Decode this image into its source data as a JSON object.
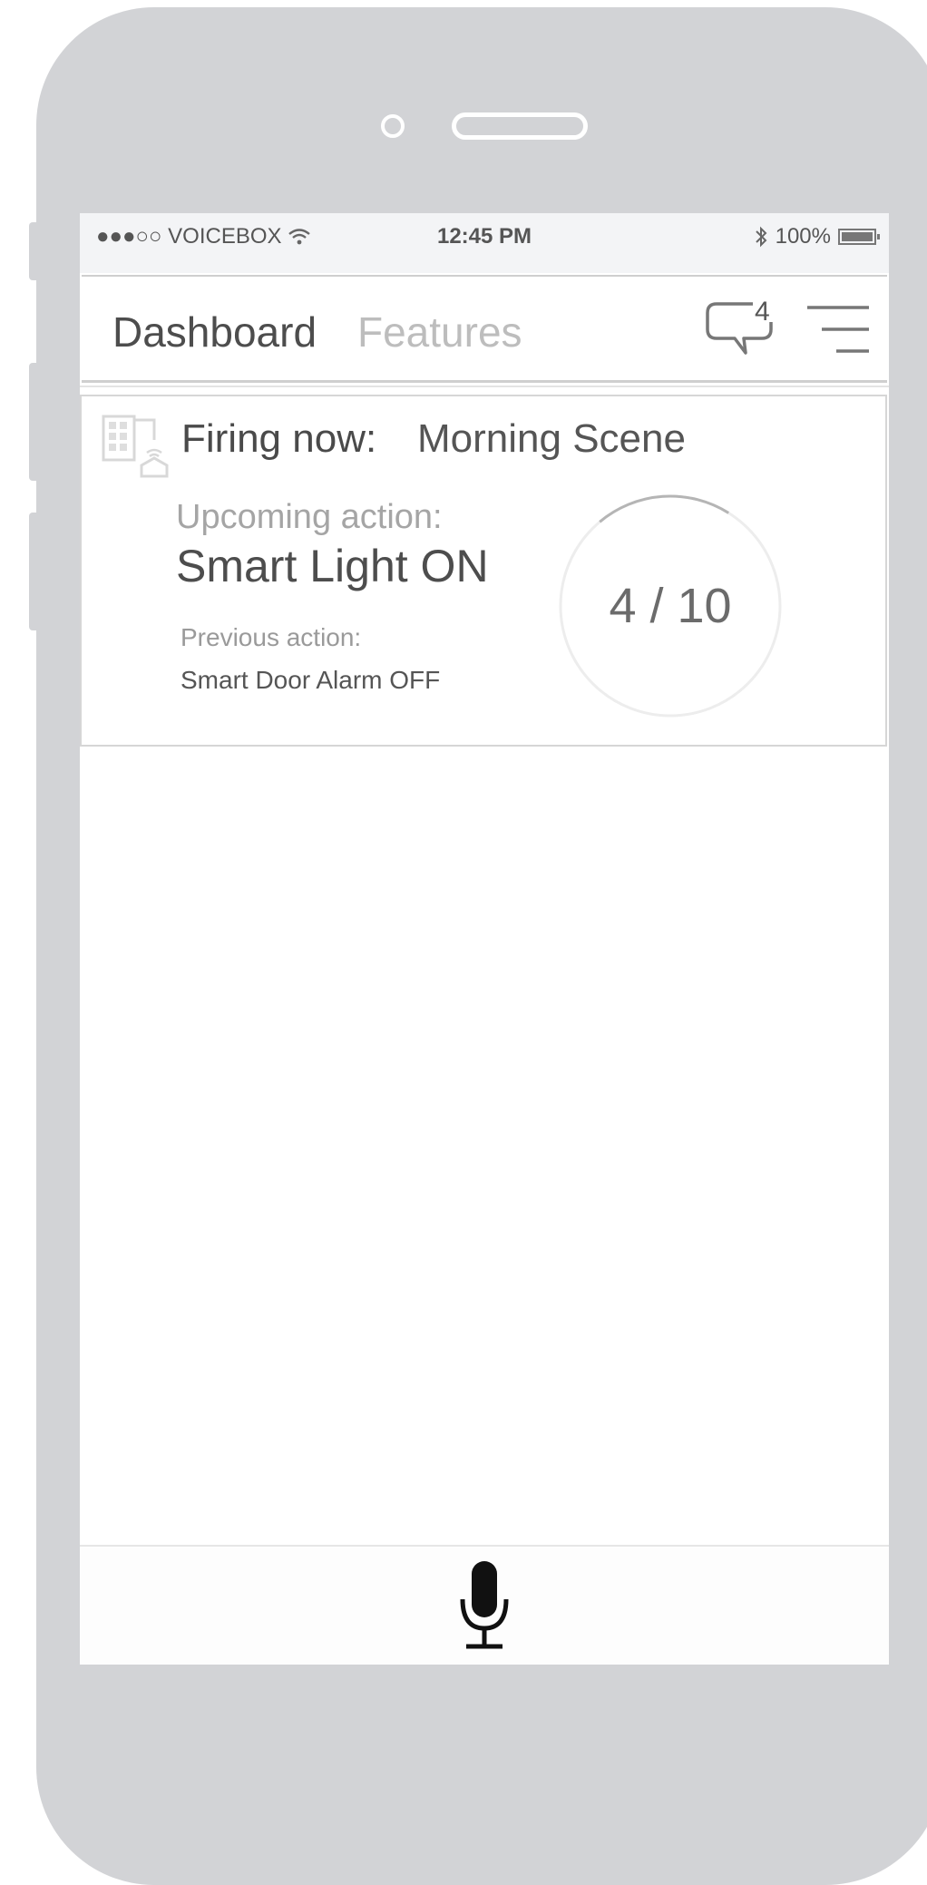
{
  "status_bar": {
    "carrier": "●●●○○ VOICEBOX",
    "time": "12:45 PM",
    "battery": "100%"
  },
  "header": {
    "tab_dashboard": "Dashboard",
    "tab_features": "Features",
    "message_count": "4"
  },
  "scene_card": {
    "firing_label": "Firing now:",
    "scene_name": "Morning Scene",
    "upcoming_label": "Upcoming action:",
    "upcoming_value": "Smart Light ON",
    "previous_label": "Previous action:",
    "previous_value": "Smart Door Alarm OFF",
    "progress_text": "4 / 10",
    "progress_current": 4,
    "progress_total": 10
  },
  "colors": {
    "phone_shell": "#d2d3d6",
    "text_dark": "#4d4d4d",
    "text_muted": "#a5a5a5"
  }
}
